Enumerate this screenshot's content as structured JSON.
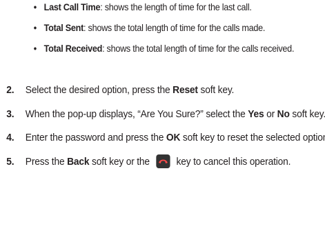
{
  "bullets": [
    {
      "term": "Last Call Time",
      "desc": ": shows the length of time for the last call."
    },
    {
      "term": "Total Sent",
      "desc": ": shows the total length of time for the calls made."
    },
    {
      "term": "Total Received",
      "desc": ": shows the total length of time for the calls received."
    }
  ],
  "steps": [
    {
      "num": "2.",
      "t1": "Select the desired option, press the ",
      "b1": "Reset",
      "t2": " soft key."
    },
    {
      "num": "3.",
      "t1": "When the pop-up displays, “Are You Sure?” select the ",
      "b1": "Yes",
      "t2": " or ",
      "b2": "No",
      "t3": " soft key."
    },
    {
      "num": "4.",
      "t1": "Enter the password and press the ",
      "b1": "OK",
      "t2": " soft key to reset the selected option."
    },
    {
      "num": "5.",
      "t1": "Press the ",
      "b1": "Back",
      "t2": " soft key or the ",
      "icon": "end-key-icon",
      "t3": " key to cancel this operation."
    }
  ]
}
